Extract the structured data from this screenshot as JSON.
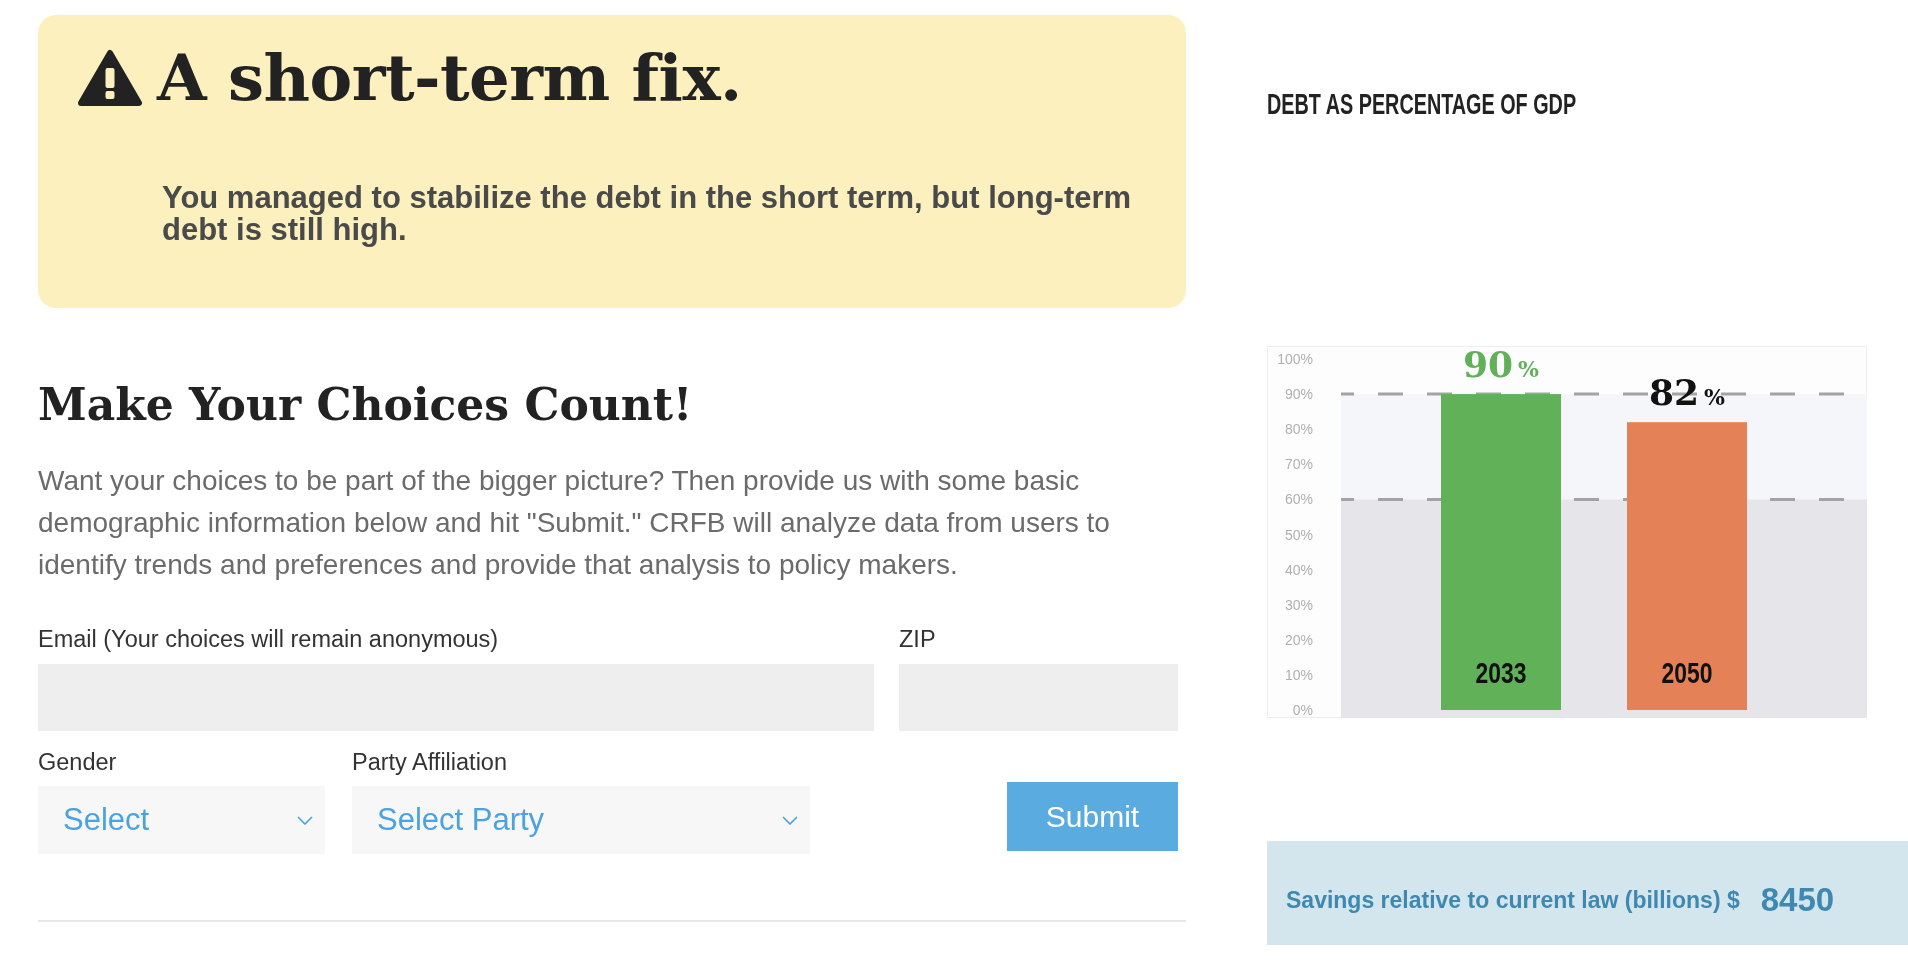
{
  "alert": {
    "title": "A short-term fix.",
    "message": "You managed to stabilize the debt in the short term, but long-term debt is still high."
  },
  "form": {
    "heading": "Make Your Choices Count!",
    "intro": "Want your choices to be part of the bigger picture? Then provide us with some basic demographic information below and hit \"Submit.\" CRFB will analyze data from users to identify trends and preferences and provide that analysis to policy makers.",
    "rows": [
      {
        "fields": [
          {
            "kind": "text",
            "label": "Email (Your choices will remain anonymous)"
          },
          {
            "kind": "text",
            "label": "ZIP"
          }
        ]
      },
      {
        "fields": [
          {
            "kind": "select",
            "label": "Gender",
            "value": "Select"
          },
          {
            "kind": "select",
            "label": "Party Affiliation",
            "value": "Select Party"
          }
        ]
      }
    ],
    "submit": "Submit"
  },
  "debt_chart": {
    "chart_data": {
      "type": "bar",
      "title": "DEBT AS PERCENTAGE OF GDP",
      "categories": [
        "2033",
        "2050"
      ],
      "series": [
        {
          "color": "#60b158",
          "values": [
            90,
            null
          ]
        },
        {
          "color": "#e48157",
          "values": [
            null,
            82
          ]
        }
      ],
      "stacked": true,
      "ylim": [
        0,
        100
      ],
      "yticks": [
        {
          "value": 0,
          "label": "0%"
        },
        {
          "value": 10,
          "label": "10%"
        },
        {
          "value": 20,
          "label": "20%"
        },
        {
          "value": 30,
          "label": "30%"
        },
        {
          "value": 40,
          "label": "40%"
        },
        {
          "value": 50,
          "label": "50%"
        },
        {
          "value": 60,
          "label": "60%"
        },
        {
          "value": 70,
          "label": "70%"
        },
        {
          "value": 80,
          "label": "80%"
        },
        {
          "value": 90,
          "label": "90%"
        },
        {
          "value": 100,
          "label": "100%"
        }
      ],
      "value_labels": [
        "90%",
        "82%"
      ],
      "ref_lines": [
        {
          "axis": "y",
          "value": 90
        },
        {
          "axis": "y",
          "value": 60
        }
      ],
      "bands": [
        {
          "axis": "y",
          "from": 60,
          "to": 90,
          "color": "#f5f6fa"
        },
        {
          "axis": "y",
          "from": 0,
          "to": 60,
          "color": "#e6e6ea"
        }
      ]
    }
  },
  "savings": {
    "label": "Savings relative to current law (billions) $",
    "value": "8450"
  }
}
